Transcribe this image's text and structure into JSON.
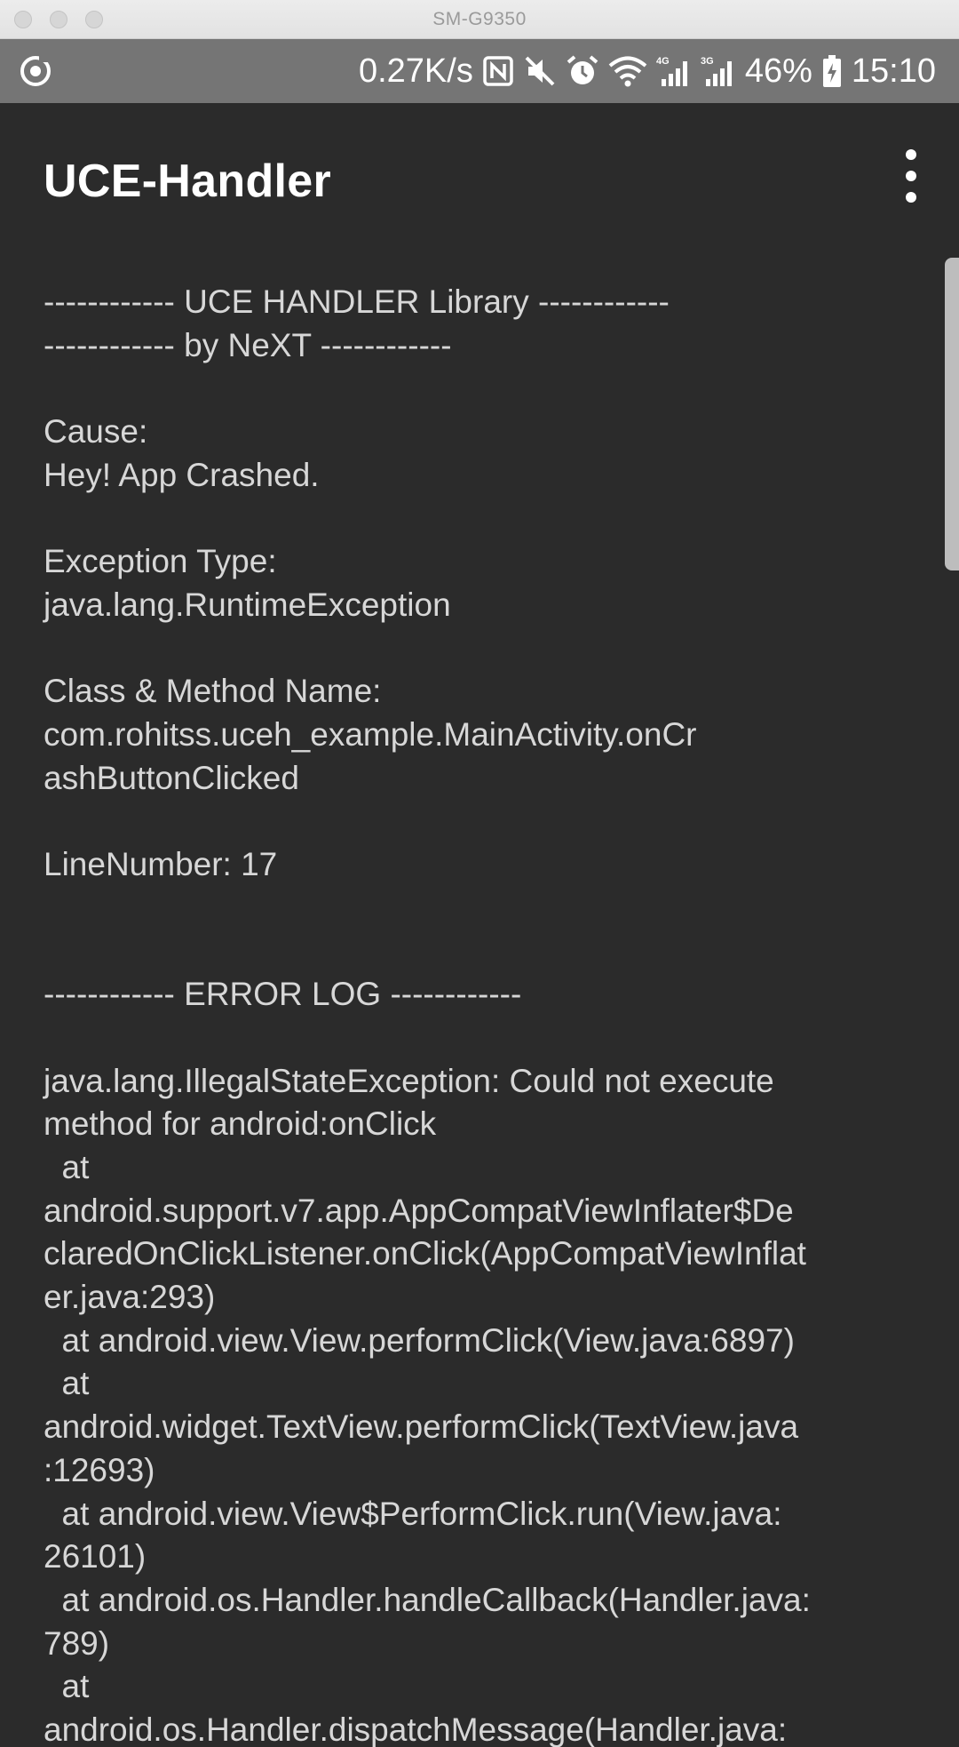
{
  "window": {
    "title": "SM-G9350"
  },
  "status_bar": {
    "speed": "0.27K/s",
    "battery": "46%",
    "time": "15:10",
    "icons": [
      "sync-icon",
      "nfc-icon",
      "mute-icon",
      "alarm-icon",
      "wifi-icon",
      "signal-4g-icon",
      "signal-3g-icon",
      "battery-icon"
    ]
  },
  "app_bar": {
    "title": "UCE-Handler",
    "menu_icon": "more-vert-icon"
  },
  "log_lines": [
    "------------ UCE HANDLER Library ------------",
    "------------ by NeXT ------------",
    "",
    "Cause:",
    "Hey! App Crashed.",
    "",
    "Exception Type:",
    "java.lang.RuntimeException",
    "",
    "Class & Method Name:",
    "com.rohitss.uceh_example.MainActivity.onCr",
    "ashButtonClicked",
    "",
    "LineNumber: 17",
    "",
    "",
    "------------ ERROR LOG ------------",
    "",
    "java.lang.IllegalStateException: Could not execute",
    "method for android:onClick",
    "  at",
    "android.support.v7.app.AppCompatViewInflater$De",
    "claredOnClickListener.onClick(AppCompatViewInflat",
    "er.java:293)",
    "  at android.view.View.performClick(View.java:6897)",
    "  at",
    "android.widget.TextView.performClick(TextView.java",
    ":12693)",
    "  at android.view.View$PerformClick.run(View.java:",
    "26101)",
    "  at android.os.Handler.handleCallback(Handler.java:",
    "789)",
    "  at",
    "android.os.Handler.dispatchMessage(Handler.java:"
  ]
}
